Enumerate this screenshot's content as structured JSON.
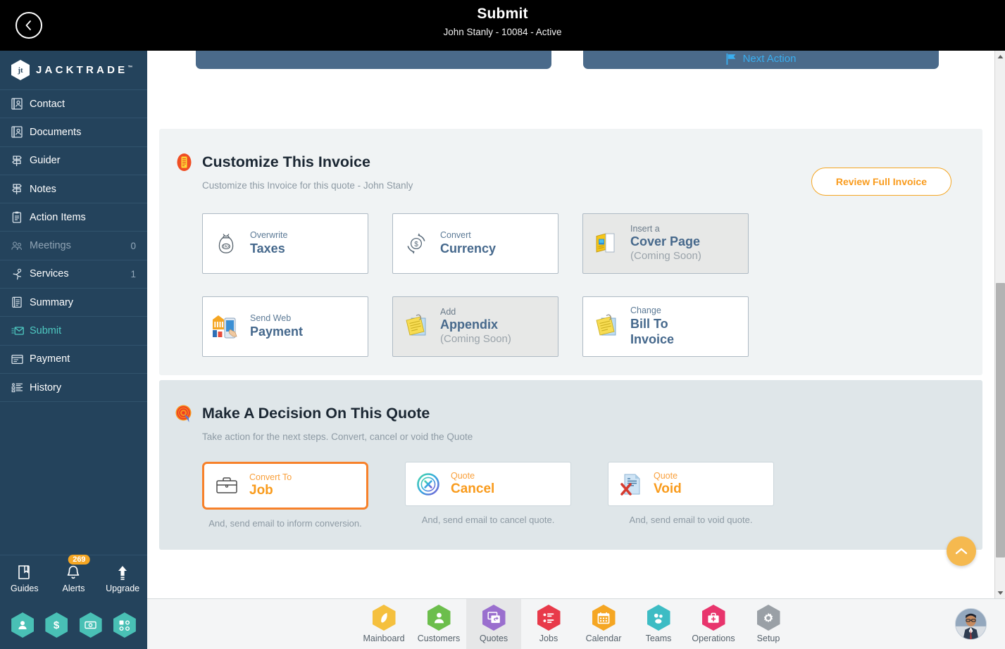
{
  "header": {
    "title": "Submit",
    "subtitle": "John Stanly - 10084 - Active",
    "back_icon": "chevron-left-icon"
  },
  "brand": {
    "mark": "jt",
    "name": "JACKTRADE",
    "tm": "™"
  },
  "sidebar": {
    "items": [
      {
        "label": "Contact",
        "icon": "contact-card-icon",
        "count": "",
        "state": "normal"
      },
      {
        "label": "Documents",
        "icon": "document-icon",
        "count": "",
        "state": "normal"
      },
      {
        "label": "Guider",
        "icon": "signpost-icon",
        "count": "",
        "state": "normal"
      },
      {
        "label": "Notes",
        "icon": "signpost-icon",
        "count": "",
        "state": "normal"
      },
      {
        "label": "Action Items",
        "icon": "clipboard-icon",
        "count": "",
        "state": "normal"
      },
      {
        "label": "Meetings",
        "icon": "meeting-icon",
        "count": "0",
        "state": "dim"
      },
      {
        "label": "Services",
        "icon": "service-runner-icon",
        "count": "1",
        "state": "normal"
      },
      {
        "label": "Summary",
        "icon": "summary-book-icon",
        "count": "",
        "state": "normal"
      },
      {
        "label": "Submit",
        "icon": "submit-envelope-icon",
        "count": "",
        "state": "active"
      },
      {
        "label": "Payment",
        "icon": "payment-card-icon",
        "count": "",
        "state": "normal"
      },
      {
        "label": "History",
        "icon": "history-list-icon",
        "count": "",
        "state": "normal"
      }
    ],
    "tools": [
      {
        "label": "Guides",
        "icon": "book-icon",
        "badge": ""
      },
      {
        "label": "Alerts",
        "icon": "bell-icon",
        "badge": "269"
      },
      {
        "label": "Upgrade",
        "icon": "arrow-up-icon",
        "badge": ""
      }
    ],
    "hex_shortcuts": [
      {
        "icon": "person-icon",
        "color": "#49c0b5"
      },
      {
        "icon": "dollar-icon",
        "color": "#49c0b5"
      },
      {
        "icon": "money-bill-icon",
        "color": "#49c0b5"
      },
      {
        "icon": "workflow-icon",
        "color": "#49c0b5"
      }
    ]
  },
  "top_panels": {
    "next_action_label": "Next Action",
    "next_action_icon": "flag-icon"
  },
  "customize_section": {
    "icon": "invoice-badge-icon",
    "title": "Customize This Invoice",
    "subtitle": "Customize this Invoice for this quote - John Stanly",
    "review_button": "Review Full Invoice",
    "cards": [
      {
        "small": "Overwrite",
        "big": "Taxes",
        "note": "",
        "icon": "tax-bag-icon",
        "disabled": false
      },
      {
        "small": "Convert",
        "big": "Currency",
        "note": "",
        "icon": "currency-cycle-icon",
        "disabled": false
      },
      {
        "small": "Insert a",
        "big": "Cover Page",
        "note": "(Coming Soon)",
        "icon": "cover-page-icon",
        "disabled": true
      },
      {
        "small": "Send Web",
        "big": "Payment",
        "note": "",
        "icon": "web-payment-icon",
        "disabled": false
      },
      {
        "small": "Add",
        "big": "Appendix",
        "note": "(Coming Soon)",
        "icon": "appendix-note-icon",
        "disabled": true
      },
      {
        "small": "Change",
        "big": "Bill To",
        "big2": "Invoice",
        "note": "",
        "icon": "appendix-note-icon",
        "disabled": false
      }
    ]
  },
  "decision_section": {
    "icon": "target-cursor-icon",
    "title": "Make A Decision On This Quote",
    "subtitle": "Take action for the next steps. Convert, cancel or void the Quote",
    "cards": [
      {
        "small": "Convert To",
        "big": "Job",
        "note": "And, send email to inform conversion.",
        "icon": "briefcase-icon",
        "selected": true
      },
      {
        "small": "Quote",
        "big": "Cancel",
        "note": "And, send email to cancel quote.",
        "icon": "circle-x-icon",
        "selected": false
      },
      {
        "small": "Quote",
        "big": "Void",
        "note": "And, send email to void quote.",
        "icon": "void-document-icon",
        "selected": false
      }
    ]
  },
  "scroll_top": {
    "icon": "chevron-up-icon"
  },
  "bottom_nav": {
    "items": [
      {
        "label": "Mainboard",
        "icon": "feather-icon",
        "color": "#f5c03e",
        "active": false
      },
      {
        "label": "Customers",
        "icon": "person-icon",
        "color": "#6cbe4c",
        "active": false
      },
      {
        "label": "Quotes",
        "icon": "quotes-icon",
        "color": "#9a6fce",
        "active": true
      },
      {
        "label": "Jobs",
        "icon": "tasklist-icon",
        "color": "#e83a4a",
        "active": false
      },
      {
        "label": "Calendar",
        "icon": "calendar-icon",
        "color": "#f5a623",
        "active": false
      },
      {
        "label": "Teams",
        "icon": "teams-icon",
        "color": "#3dbcc4",
        "active": false
      },
      {
        "label": "Operations",
        "icon": "toolbox-icon",
        "color": "#e8356d",
        "active": false
      },
      {
        "label": "Setup",
        "icon": "gear-icon",
        "color": "#9aa0a6",
        "active": false
      }
    ],
    "avatar_icon": "user-avatar"
  },
  "colors": {
    "topbar_bg": "#000000",
    "sidebar_bg": "#24435c",
    "accent_teal": "#4ec9c1",
    "accent_orange": "#f99b1c",
    "panel_a_bg": "#f0f3f4",
    "panel_b_bg": "#dfe6e9",
    "card_blue_text": "#45688c",
    "topcard_bg": "#4a6a8a"
  }
}
